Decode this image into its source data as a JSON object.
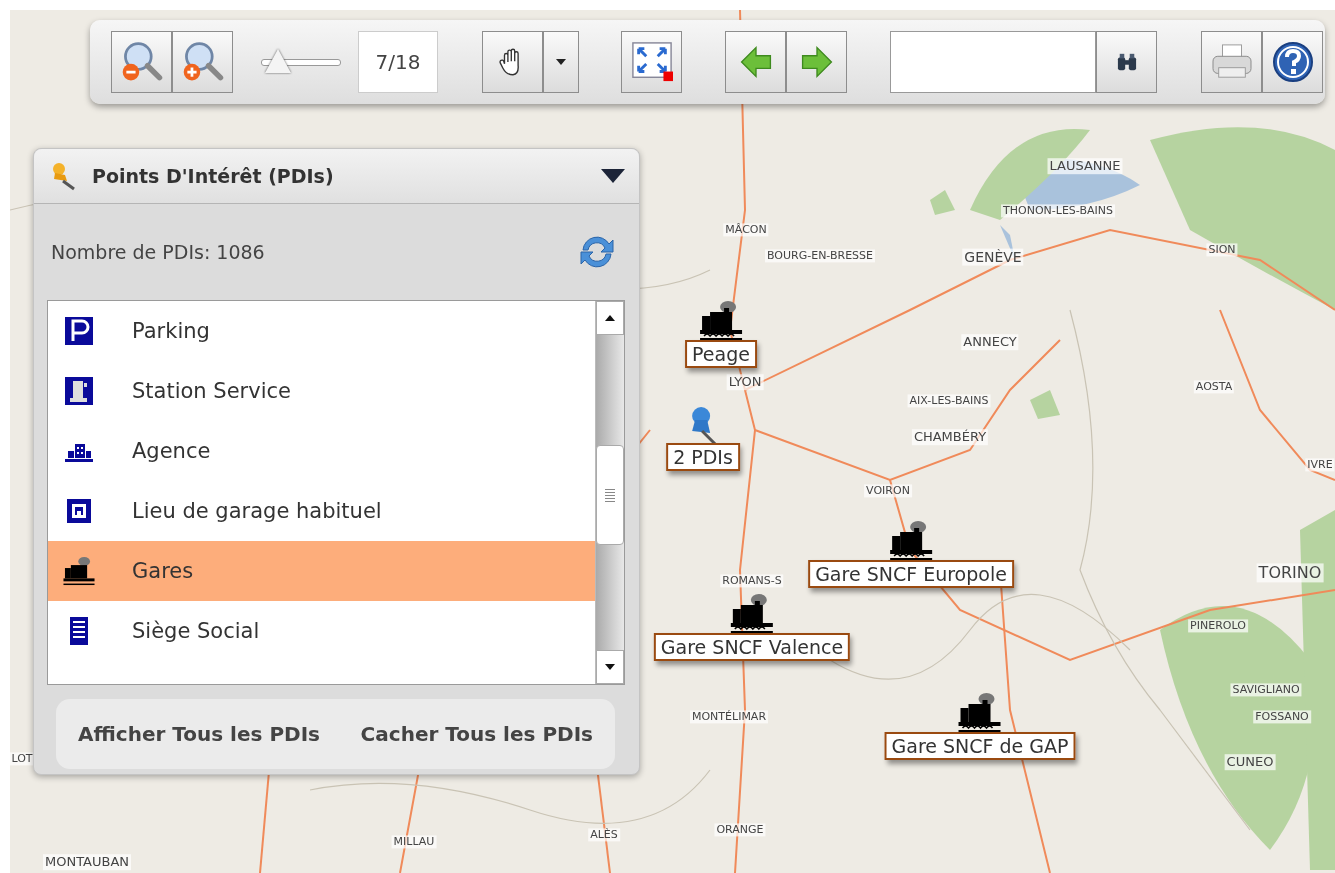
{
  "toolbar": {
    "zoom_level": "7/18",
    "zoom_slider": {
      "level": 0.12
    }
  },
  "poi_panel": {
    "title": "Points D'Intérêt (PDIs)",
    "count_label": "Nombre de PDIs: 1086",
    "categories": [
      {
        "label": "Parking",
        "kind": "parking",
        "selected": false
      },
      {
        "label": "Station Service",
        "kind": "fuel",
        "selected": false
      },
      {
        "label": "Agence",
        "kind": "agency",
        "selected": false
      },
      {
        "label": "Lieu de garage habituel",
        "kind": "garage",
        "selected": false
      },
      {
        "label": "Gares",
        "kind": "train",
        "selected": true
      },
      {
        "label": "Siège Social",
        "kind": "office",
        "selected": false
      }
    ],
    "buttons": [
      "Afficher Tous les PDIs",
      "Cacher Tous les PDIs"
    ]
  },
  "map": {
    "place_labels": [
      "LAUSANNE",
      "THONON-LES-BAINS",
      "MÂCON",
      "SION",
      "BOURG-EN-BRESSE",
      "GENÈVE",
      "ANNECY",
      "LYON",
      "AOSTA",
      "AIX-LES-BAINS",
      "CHAMBÉRY",
      "IVRE",
      "VOIRON",
      "TORINO",
      "ROMANS-S",
      "PINEROLO",
      "SAVIGLIANO",
      "MONTÉLIMAR",
      "FOSSANO",
      "CUNEO",
      "LOT",
      "ALÈS",
      "ORANGE",
      "MILLAU",
      "MONTAUBAN"
    ],
    "markers": [
      {
        "kind": "train",
        "label": "Peage"
      },
      {
        "kind": "pin",
        "label": "2 PDIs"
      },
      {
        "kind": "train",
        "label": "Gare SNCF Europole"
      },
      {
        "kind": "train",
        "label": "Gare SNCF Valence"
      },
      {
        "kind": "train",
        "label": "Gare SNCF de GAP"
      }
    ]
  }
}
